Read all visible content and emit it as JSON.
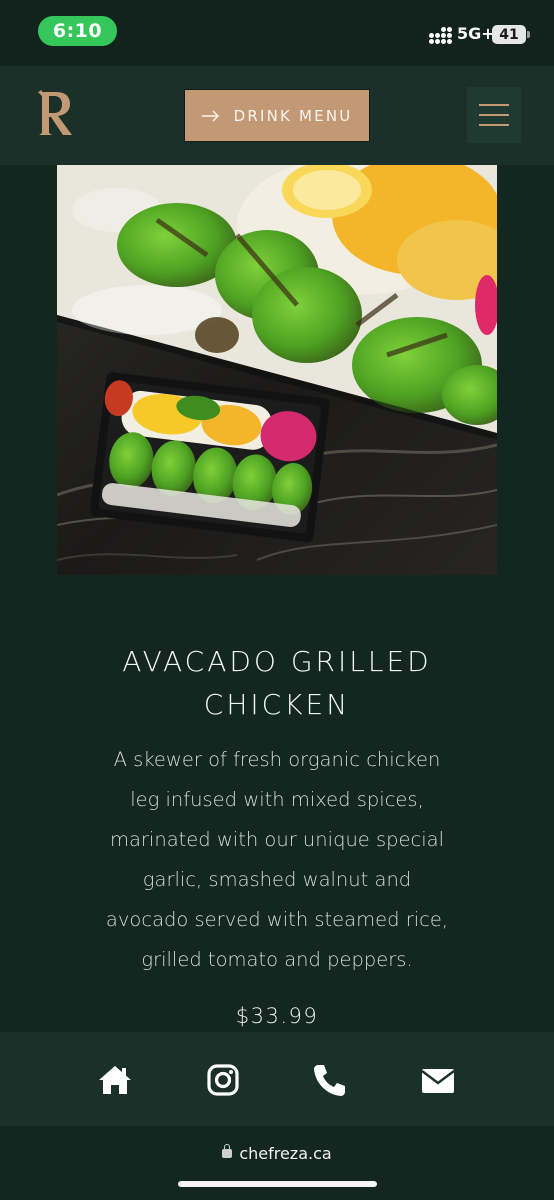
{
  "status_bar": {
    "time": "6:10",
    "network": "5G+",
    "battery": "41"
  },
  "header": {
    "logo_letter": "R",
    "drink_menu_label": "DRINK MENU",
    "menu_icon": "hamburger-icon",
    "accent_color": "#c39874"
  },
  "dish": {
    "title_line1": "AVACADO GRILLED",
    "title_line2": "CHICKEN",
    "description_lines": [
      "A skewer of fresh organic chicken",
      "leg infused with mixed spices,",
      "marinated with our unique special",
      "garlic, smashed walnut and",
      "avocado served with steamed rice,",
      "grilled tomato and peppers."
    ],
    "price": "$33.99"
  },
  "bottom_nav": {
    "items": [
      {
        "icon": "home-icon"
      },
      {
        "icon": "instagram-icon"
      },
      {
        "icon": "phone-icon"
      },
      {
        "icon": "mail-icon"
      }
    ]
  },
  "browser": {
    "url": "chefreza.ca"
  },
  "colors": {
    "background": "#13261f",
    "panel": "#1b3029",
    "status_pill": "#35c759"
  }
}
